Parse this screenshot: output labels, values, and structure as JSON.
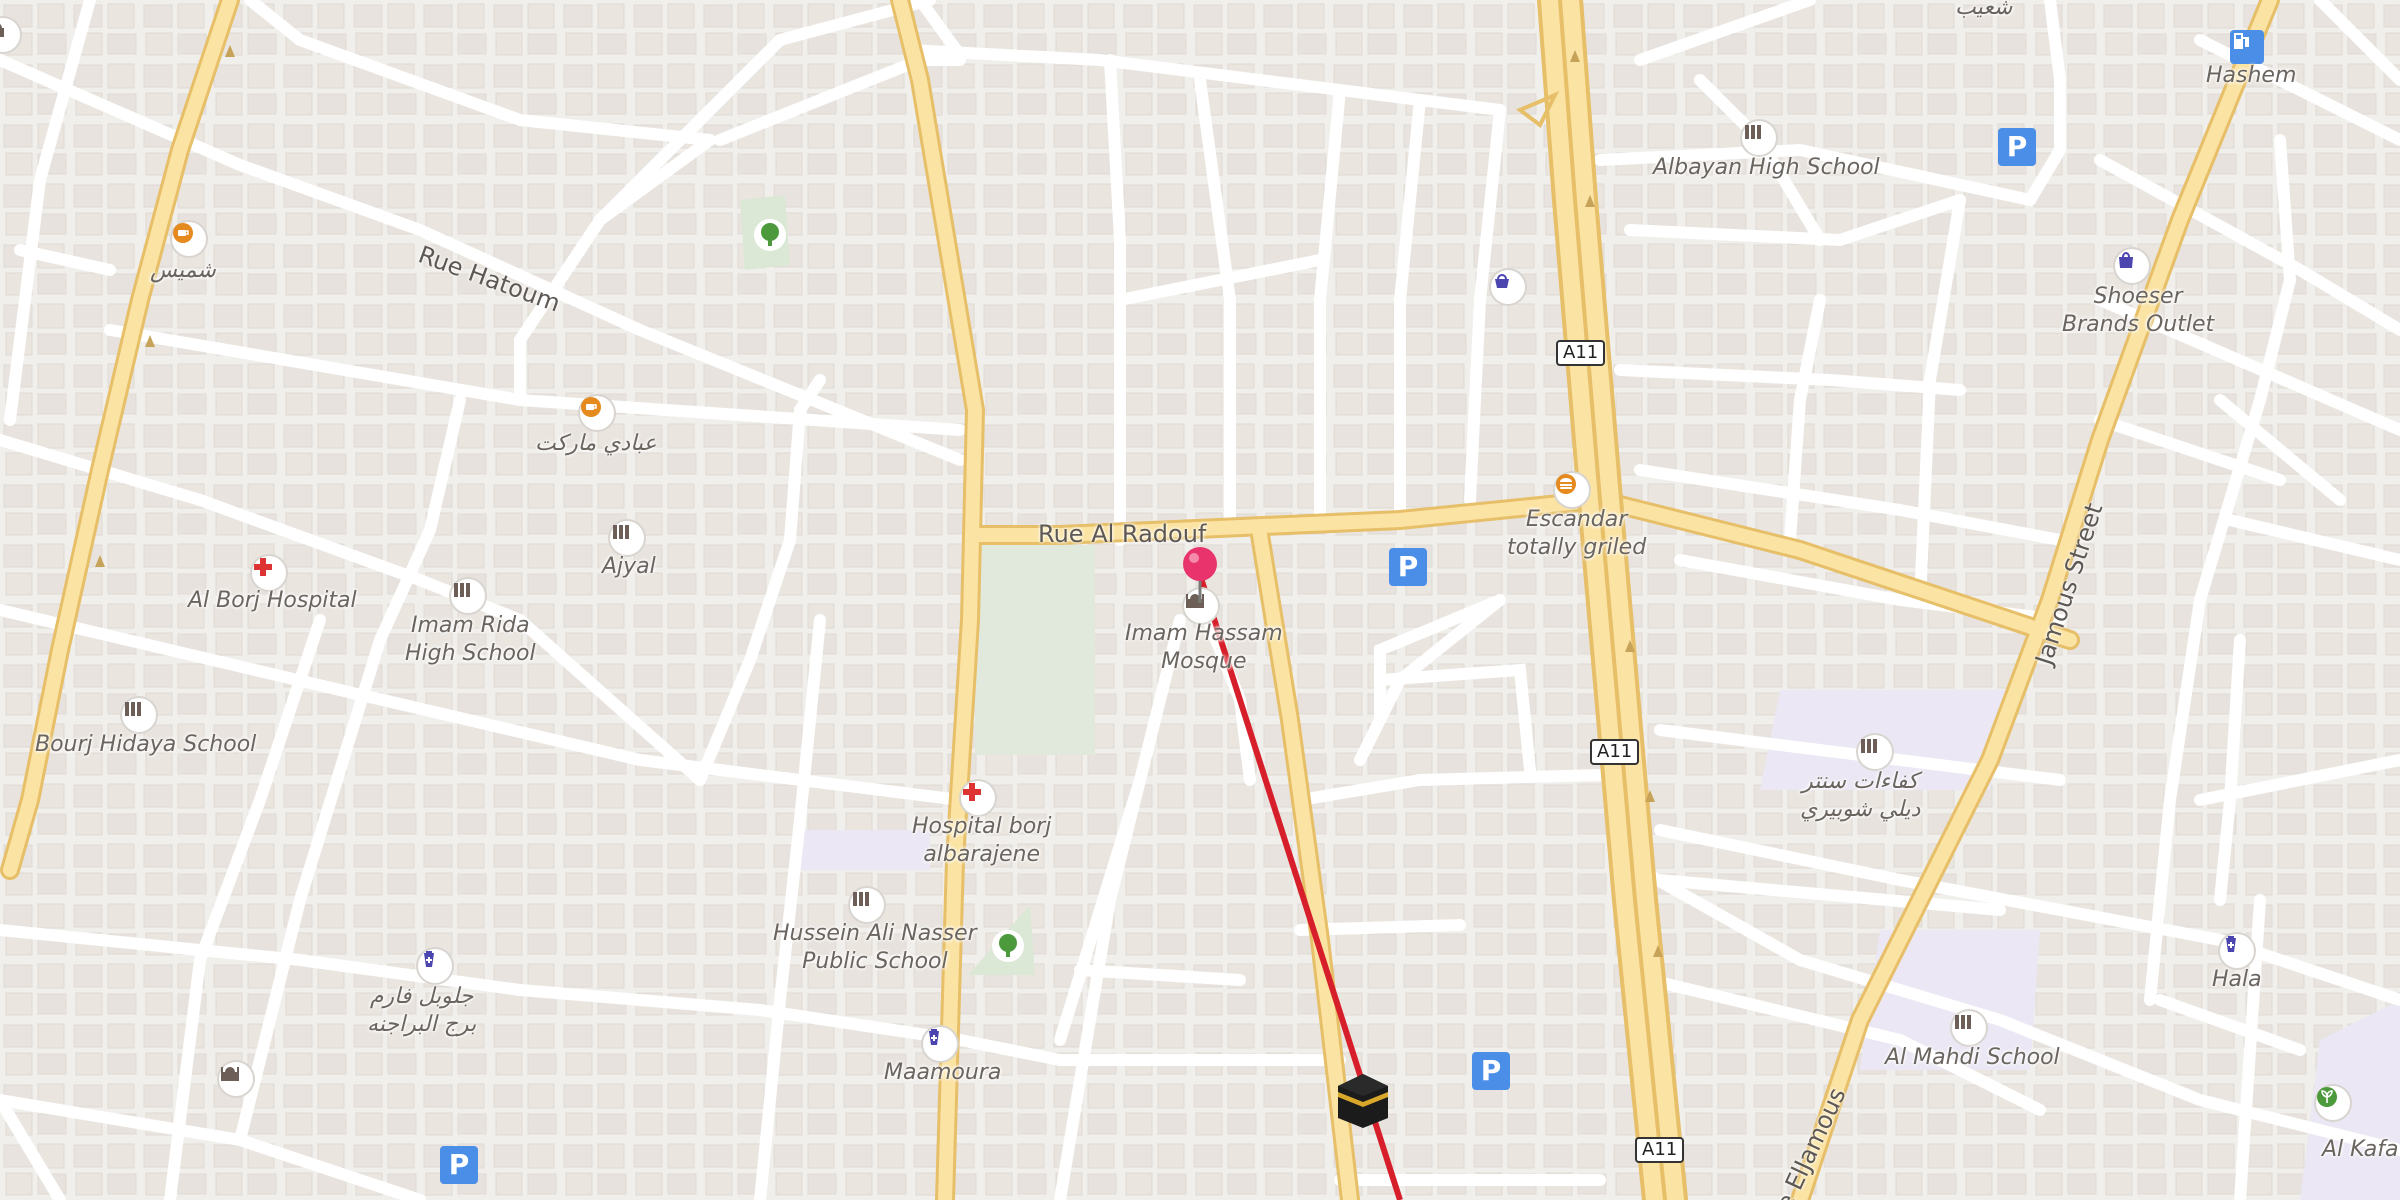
{
  "map": {
    "roads": {
      "rue_hatoum": "Rue Hatoum",
      "rue_al_radouf": "Rue Al Radouf",
      "jamous_street": "Jamous Street",
      "rue_eljamous_partial": "e ElJamous"
    },
    "route_shields": [
      "A11",
      "A11",
      "A11"
    ],
    "places": [
      {
        "id": "shmeis",
        "label": "شميس",
        "icon": "cafe-icon"
      },
      {
        "id": "abbadi",
        "label": "عبادي ماركت",
        "icon": "cafe-icon"
      },
      {
        "id": "al_borj_hospital",
        "label": "Al Borj Hospital",
        "icon": "hospital-icon"
      },
      {
        "id": "ajyal",
        "label": "Ajyal",
        "icon": "school-icon"
      },
      {
        "id": "imam_rida",
        "label_line1": "Imam Rida",
        "label_line2": "High School",
        "icon": "school-icon"
      },
      {
        "id": "bourj_hidaya",
        "label": "Bourj Hidaya School",
        "icon": "school-icon"
      },
      {
        "id": "hospital_borj",
        "label_line1": "Hospital borj",
        "label_line2": "albarajene",
        "icon": "hospital-icon"
      },
      {
        "id": "hussein",
        "label_line1": "Hussein Ali Nasser",
        "label_line2": "Public School",
        "icon": "school-icon"
      },
      {
        "id": "pharmacy_borj",
        "label_line1": "جلوبل فارم",
        "label_line2": "برج البراجنه",
        "icon": "pharmacy-icon"
      },
      {
        "id": "maamoura",
        "label": "Maamoura",
        "icon": "pharmacy-icon"
      },
      {
        "id": "imam_hassam",
        "label_line1": "Imam Hassam",
        "label_line2": "Mosque",
        "icon": "mosque-icon"
      },
      {
        "id": "escandar",
        "label_line1": "Escandar",
        "label_line2": "totally griled",
        "icon": "burger-icon"
      },
      {
        "id": "albayan",
        "label": "Albayan High School",
        "icon": "school-icon"
      },
      {
        "id": "shaeib",
        "label": "شعيب",
        "icon": ""
      },
      {
        "id": "hashem",
        "label": "Hashem",
        "icon": "fuel-icon"
      },
      {
        "id": "shoeser",
        "label_line1": "Shoeser",
        "label_line2": "Brands Outlet",
        "icon": "shopping-bag-icon"
      },
      {
        "id": "kafaat",
        "label_line1": "كفاءات سنتر",
        "label_line2": "ديلي شوبيري",
        "icon": "school-icon"
      },
      {
        "id": "hala",
        "label": "Hala",
        "icon": "pharmacy-icon"
      },
      {
        "id": "al_mahdi",
        "label": "Al Mahdi School",
        "icon": "school-icon"
      },
      {
        "id": "al_kafaat_partial",
        "label": "Al Kafa",
        "icon": "garden-icon"
      }
    ],
    "colors": {
      "background": "#f1efec",
      "building": "#e6e1dc",
      "minor_road": "#ffffff",
      "major_road": "#fbe2a0",
      "major_road_casing": "#e8c06a",
      "route_line": "#d61f2a",
      "pin": "#e8336d",
      "parking": "#4a8ee8",
      "park": "#dfe9d9"
    }
  }
}
